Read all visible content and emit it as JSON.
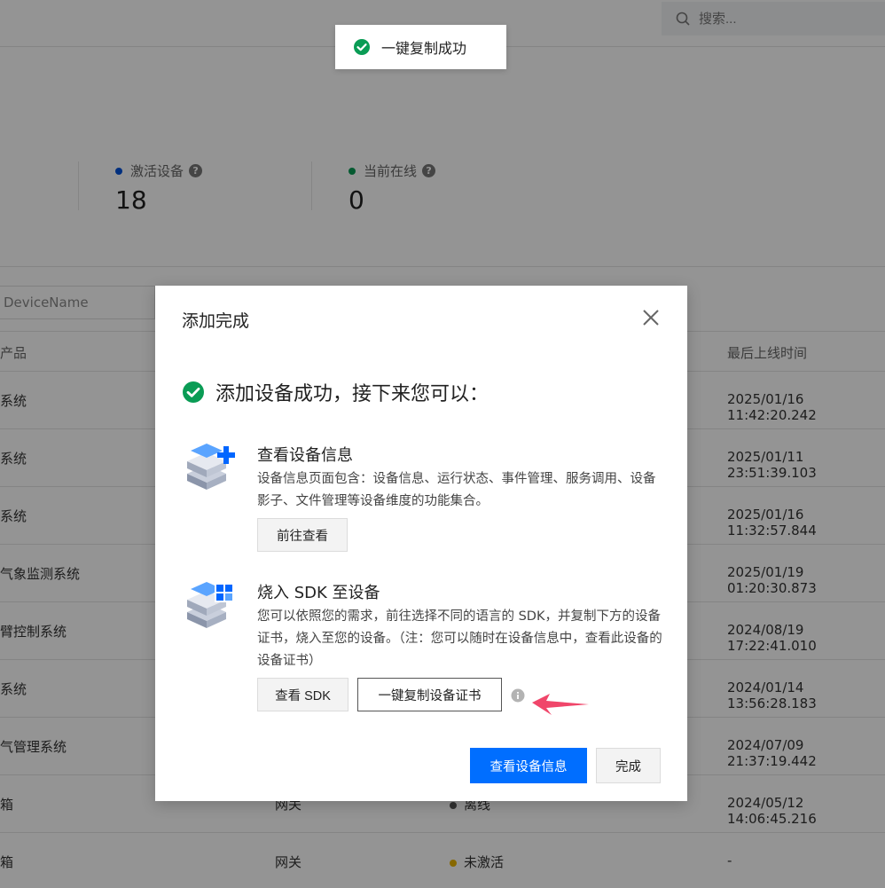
{
  "search": {
    "placeholder": "搜索..."
  },
  "toast": {
    "message": "一键复制成功"
  },
  "stats": [
    {
      "label": "激活设备",
      "value": "18",
      "color": "#0052d9"
    },
    {
      "label": "当前在线",
      "value": "0",
      "color": "#0a9c55"
    }
  ],
  "filter": {
    "placeholder": "DeviceName"
  },
  "table": {
    "headers": {
      "product": "产品",
      "last_online": "最后上线时间"
    },
    "rows": [
      {
        "product": "系统",
        "last_online": "2025/01/16 11:42:20.242"
      },
      {
        "product": "系统",
        "last_online": "2025/01/11 23:51:39.103"
      },
      {
        "product": "系统",
        "last_online": "2025/01/16 11:32:57.844"
      },
      {
        "product": "气象监测系统",
        "last_online": "2025/01/19 01:20:30.873"
      },
      {
        "product": "臂控制系统",
        "last_online": "2024/08/19 17:22:41.010"
      },
      {
        "product": "系统",
        "last_online": "2024/01/14 13:56:28.183"
      },
      {
        "product": "气管理系统",
        "last_online": "2024/07/09 21:37:19.442"
      },
      {
        "product": "箱",
        "type": "网关",
        "status": "离线",
        "status_color": "#555555",
        "last_online": "2024/05/12 14:06:45.216"
      },
      {
        "product": "箱",
        "type": "网关",
        "status": "未激活",
        "status_color": "#e8b400",
        "last_online": "-"
      }
    ]
  },
  "modal": {
    "title": "添加完成",
    "success_text": "添加设备成功，接下来您可以：",
    "section1": {
      "icon": "device-add-icon",
      "title": "查看设备信息",
      "desc": "设备信息页面包含：设备信息、运行状态、事件管理、服务调用、设备影子、文件管理等设备维度的功能集合。",
      "button": "前往查看"
    },
    "section2": {
      "icon": "device-sdk-icon",
      "title": "烧入 SDK 至设备",
      "desc": "您可以依照您的需求，前往选择不同的语言的 SDK，并复制下方的设备证书，烧入至您的设备。（注：您可以随时在设备信息中，查看此设备的设备证书）",
      "button_sdk": "查看 SDK",
      "button_copy": "一键复制设备证书"
    },
    "footer": {
      "primary": "查看设备信息",
      "secondary": "完成"
    }
  },
  "colors": {
    "primary": "#006eff",
    "success": "#0a9c55",
    "arrow": "#f0466a"
  }
}
